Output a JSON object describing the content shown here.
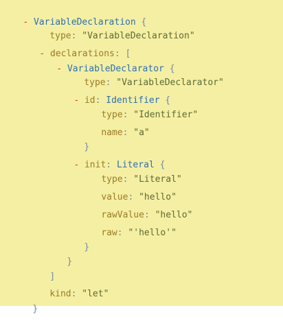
{
  "toggle_symbol": "-",
  "colors": {
    "panel_background": "#f5efa3",
    "toggle": "#d23a1f",
    "key": "#9a7b27",
    "punctuation": "#6f8aaa",
    "type_name": "#2a6fb5",
    "string": "#5b6a35"
  },
  "nodes": {
    "root": {
      "label": "VariableDeclaration",
      "open_brace": "{",
      "close_brace": "}"
    },
    "type": {
      "key": "type",
      "sep": ":",
      "value": "\"VariableDeclaration\""
    },
    "declarations": {
      "key": "declarations",
      "sep": ":",
      "open_bracket": "[",
      "close_bracket": "]"
    },
    "declarator": {
      "label": "VariableDeclarator",
      "open_brace": "{",
      "close_brace": "}"
    },
    "declarator_type": {
      "key": "type",
      "sep": ":",
      "value": "\"VariableDeclarator\""
    },
    "id": {
      "key": "id",
      "sep": ":",
      "label": "Identifier",
      "open_brace": "{",
      "close_brace": "}",
      "type": {
        "key": "type",
        "sep": ":",
        "value": "\"Identifier\""
      },
      "name": {
        "key": "name",
        "sep": ":",
        "value": "\"a\""
      }
    },
    "init": {
      "key": "init",
      "sep": ":",
      "label": "Literal",
      "open_brace": "{",
      "close_brace": "}",
      "type": {
        "key": "type",
        "sep": ":",
        "value": "\"Literal\""
      },
      "value": {
        "key": "value",
        "sep": ":",
        "value": "\"hello\""
      },
      "rawValue": {
        "key": "rawValue",
        "sep": ":",
        "value": "\"hello\""
      },
      "raw": {
        "key": "raw",
        "sep": ":",
        "value": "\"'hello'\""
      }
    },
    "kind": {
      "key": "kind",
      "sep": ":",
      "value": "\"let\""
    }
  }
}
